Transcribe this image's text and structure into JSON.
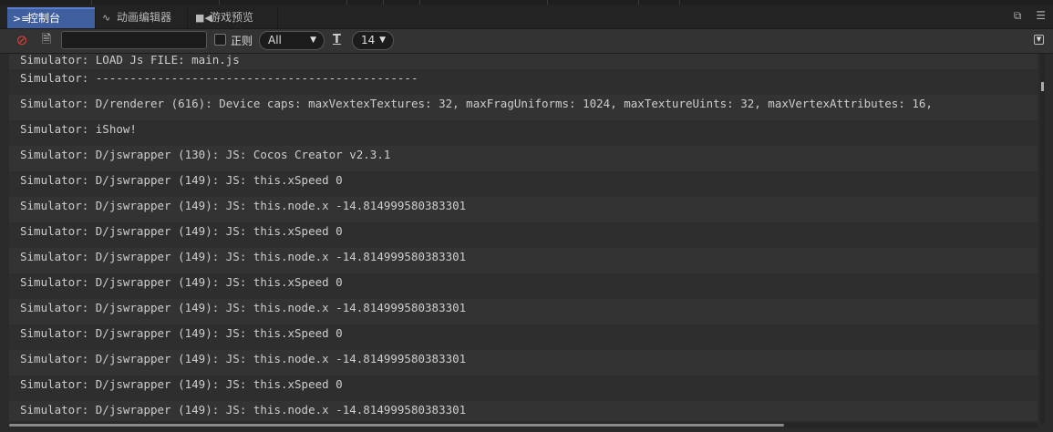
{
  "tabs": [
    {
      "label": "控制台",
      "icon": "terminal-icon"
    },
    {
      "label": "动画编辑器",
      "icon": "animation-icon"
    },
    {
      "label": "游戏预览",
      "icon": "video-camera-icon"
    }
  ],
  "toolbar": {
    "search_value": "",
    "regex_label": "正则",
    "level_value": "All",
    "font_size_value": "14"
  },
  "logs": [
    "Simulator: LOAD Js FILE: main.js",
    "Simulator: -----------------------------------------------",
    "Simulator: D/renderer (616): Device caps: maxVextexTextures: 32, maxFragUniforms: 1024, maxTextureUints: 32, maxVertexAttributes: 16,",
    "Simulator: iShow!",
    "Simulator: D/jswrapper (130): JS: Cocos Creator v2.3.1",
    "Simulator: D/jswrapper (149): JS: this.xSpeed 0",
    "Simulator: D/jswrapper (149): JS: this.node.x -14.814999580383301",
    "Simulator: D/jswrapper (149): JS: this.xSpeed 0",
    "Simulator: D/jswrapper (149): JS: this.node.x -14.814999580383301",
    "Simulator: D/jswrapper (149): JS: this.xSpeed 0",
    "Simulator: D/jswrapper (149): JS: this.node.x -14.814999580383301",
    "Simulator: D/jswrapper (149): JS: this.xSpeed 0",
    "Simulator: D/jswrapper (149): JS: this.node.x -14.814999580383301",
    "Simulator: D/jswrapper (149): JS: this.xSpeed 0",
    "Simulator: D/jswrapper (149): JS: this.node.x -14.814999580383301"
  ],
  "colors": {
    "active_tab": "#3f5f9e",
    "clear_icon": "#e0403a",
    "background": "#2b2b2b"
  }
}
